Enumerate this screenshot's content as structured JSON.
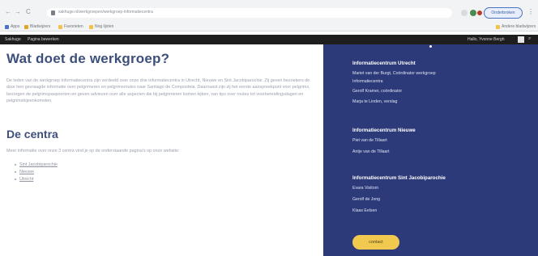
{
  "browser": {
    "nav_back": "←",
    "nav_forward": "→",
    "nav_reload": "C",
    "url": "sakhuge.nl/werkgroepen/werkgroep-informatiecentra",
    "profile_label": "Onderbroken",
    "menu": "⋮",
    "bookmarks": [
      "Apps",
      "Bladwijzers",
      "Favorieten",
      "Nog lijsten"
    ],
    "bookmarks_right": "Andere bladwijzers"
  },
  "sitebar": {
    "home": "Sakhuge",
    "edit": "Pagina bewerken",
    "user": "Hallo, Yvonne Bergh"
  },
  "main": {
    "title": "Wat doet de werkgroep?",
    "paragraph": "De leden van de werkgroep Informatiecentra zijn verdeeld over onze drie informatiecentra in Utrecht, Nieuwe en Sint Jacobiparochie. Zij geven bezoekers de door hen gevraagde informatie over pelgrimeren en pelgrimsroutes naar Santiago de Compostela. Daarnaast zijn zij het eerste aanspreekpunt voor pelgrims, bezorgen de pelgrimspaspoorten en geven adviezen over alle aspecten die bij pelgrimeren komen kijken, van tips over routes tot voorbereidingsdagen en pelgrimsbijeenkomsten.",
    "centra_title": "De centra",
    "centra_intro": "Meer informatie over onze 3 centra vind je op de onderstaande pagina's op onze website:",
    "links": [
      "Sint Jacobiparochie",
      "Nieuwe",
      "Utrecht"
    ]
  },
  "sidebar": {
    "groups": [
      {
        "title": "Informatiecentrum Utrecht",
        "lines": [
          "Mariet van der Burgt, Coördinator werkgroep",
          "Informatiecentra",
          "Gerolf Kramer, coördinator",
          "Marja te Linden, verslag"
        ]
      },
      {
        "title": "Informatiecentrum Nieuwe",
        "lines": [
          "Piet van de Tillaart",
          "Antje van de Tillaart"
        ]
      },
      {
        "title": "Informatiecentrum Sint Jacobiparochie",
        "lines": [
          "Evara Visitorn",
          "Gerolf de Jong",
          "Klaas Eelsen"
        ]
      }
    ],
    "contact_button": "contact"
  }
}
